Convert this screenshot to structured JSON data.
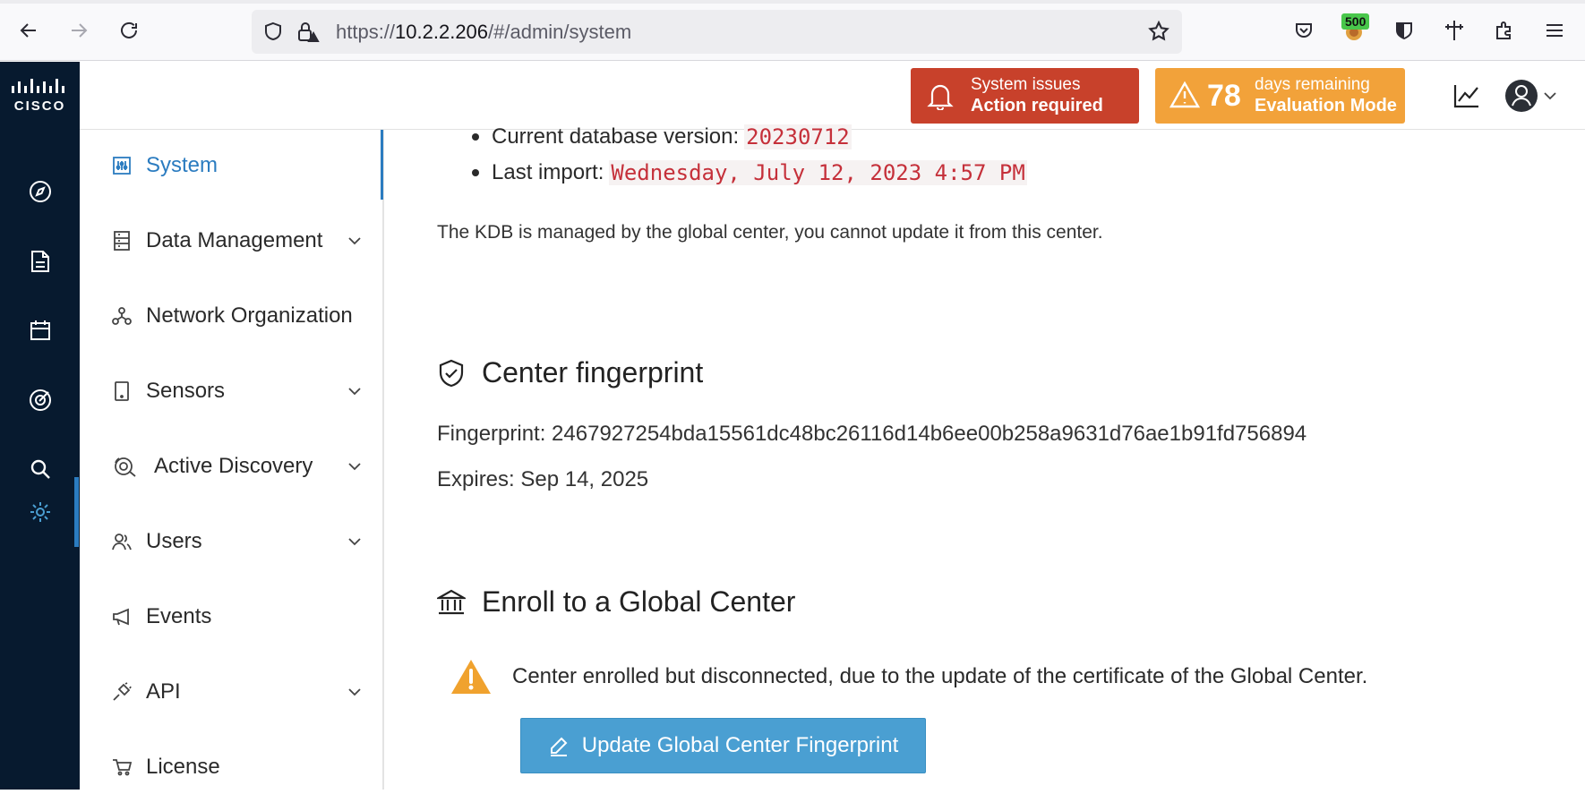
{
  "browser": {
    "url_scheme": "https://",
    "url_host": "10.2.2.206",
    "url_path": "/#/admin/system",
    "extension_badge": "500"
  },
  "header": {
    "logo_text": "CISCO",
    "issues_title": "System issues",
    "issues_action": "Action required",
    "eval_days": "78",
    "eval_line1": "days remaining",
    "eval_line2": "Evaluation Mode"
  },
  "sidebar": {
    "items": [
      {
        "label": "System"
      },
      {
        "label": "Data Management"
      },
      {
        "label": "Network Organization"
      },
      {
        "label": "Sensors"
      },
      {
        "label": "Active Discovery"
      },
      {
        "label": "Users"
      },
      {
        "label": "Events"
      },
      {
        "label": "API"
      },
      {
        "label": "License"
      }
    ]
  },
  "kdb": {
    "db_version_label": "Current database version:",
    "db_version_value": "20230712",
    "last_import_label": "Last import:",
    "last_import_value": "Wednesday, July 12, 2023 4:57 PM",
    "managed_note": "The KDB is managed by the global center, you cannot update it from this center."
  },
  "fingerprint": {
    "title": "Center fingerprint",
    "fingerprint_line": "Fingerprint: 2467927254bda15561dc48bc26116d14b6ee00b258a9631d76ae1b91fd756894",
    "expires_line": "Expires: Sep 14, 2025"
  },
  "enroll": {
    "title": "Enroll to a Global Center",
    "warning_text": "Center enrolled but disconnected, due to the update of the certificate of the Global Center.",
    "update_button": "Update Global Center Fingerprint"
  },
  "colors": {
    "rail_bg": "#071a2f",
    "accent": "#2b7cc0",
    "issues_bg": "#c8412b",
    "eval_bg": "#f2a23a",
    "button_bg": "#4a9fd2",
    "warning": "#f0a22e"
  }
}
